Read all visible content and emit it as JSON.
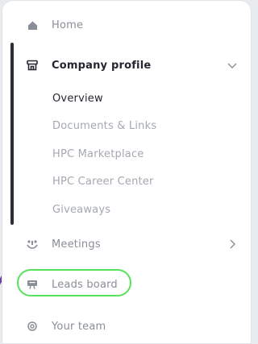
{
  "nav": {
    "home": {
      "label": "Home",
      "icon": "home-icon"
    },
    "company_profile": {
      "label": "Company profile",
      "icon": "storefront-icon",
      "expanded": true,
      "subitems": [
        {
          "label": "Overview",
          "current": true
        },
        {
          "label": "Documents & Links"
        },
        {
          "label": "HPC Marketplace"
        },
        {
          "label": "HPC Career Center"
        },
        {
          "label": "Giveaways"
        }
      ]
    },
    "meetings": {
      "label": "Meetings",
      "icon": "meetings-icon"
    },
    "leads_board": {
      "label": "Leads board",
      "icon": "presentation-board-icon"
    },
    "your_team": {
      "label": "Your team",
      "icon": "gear-icon"
    }
  },
  "colors": {
    "active_text": "#262630",
    "muted_text": "#8a8e97",
    "highlight_ring": "#56e15a",
    "deco_stroke": "#6d3fa6"
  }
}
